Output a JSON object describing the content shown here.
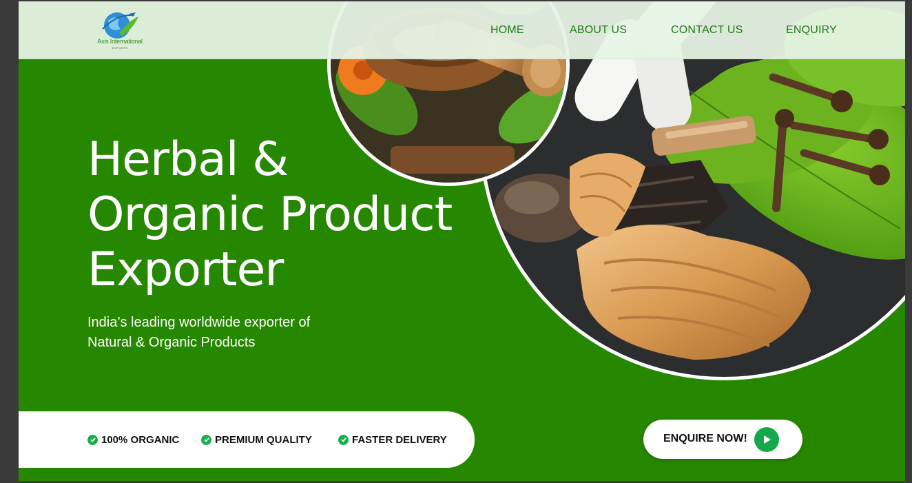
{
  "brand": {
    "name": "Axis International",
    "tagline": "EXPORTS",
    "logo_icon": "globe-leaf-plane-icon"
  },
  "nav": {
    "home": "HOME",
    "about": "ABOUT US",
    "contact": "CONTACT US",
    "enquiry": "ENQUIRY"
  },
  "hero": {
    "title_lines": [
      "Herbal &",
      "Organic Product",
      "Exporter"
    ],
    "subtitle_lines": [
      "India’s leading worldwide exporter of",
      "Natural & Organic Products"
    ]
  },
  "features": [
    {
      "label": "100% ORGANIC",
      "icon": "check-circle-icon"
    },
    {
      "label": "PREMIUM QUALITY",
      "icon": "check-circle-icon"
    },
    {
      "label": "FASTER DELIVERY",
      "icon": "check-circle-icon"
    }
  ],
  "cta": {
    "label": "ENQUIRE NOW!",
    "icon": "play-icon"
  },
  "colors": {
    "hero_green": "#268700",
    "nav_text": "#1f7a14",
    "accent_green": "#15b14c",
    "topbar_bg": "#e7f3e4"
  }
}
